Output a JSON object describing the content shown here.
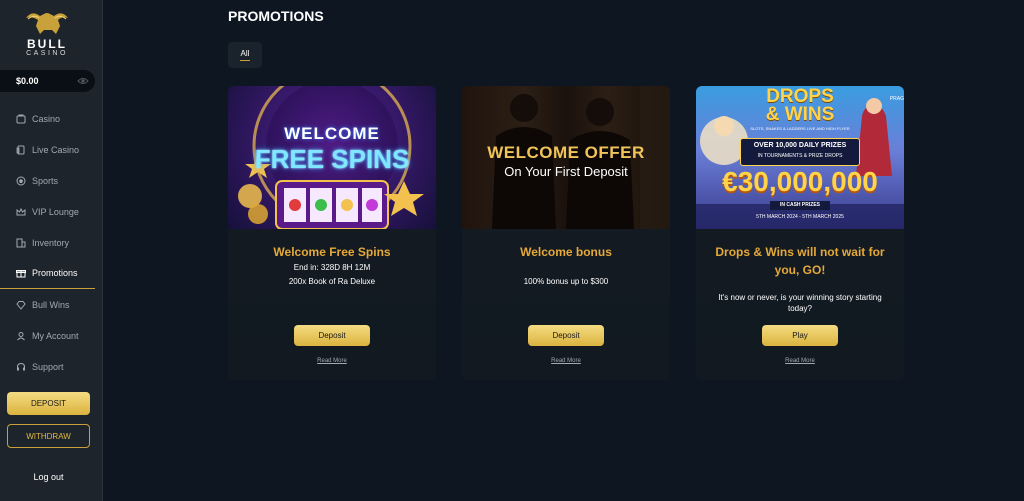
{
  "brand": {
    "word": "BULL",
    "sub": "CASINO"
  },
  "balance": {
    "amount": "$0.00"
  },
  "sidebar": {
    "items": [
      {
        "label": "Casino",
        "icon": "casino-icon"
      },
      {
        "label": "Live Casino",
        "icon": "live-casino-icon"
      },
      {
        "label": "Sports",
        "icon": "sports-icon"
      },
      {
        "label": "VIP Lounge",
        "icon": "crown-icon"
      },
      {
        "label": "Inventory",
        "icon": "inventory-icon"
      },
      {
        "label": "Promotions",
        "icon": "gift-icon",
        "active": true
      },
      {
        "label": "Bull Wins",
        "icon": "diamond-icon"
      },
      {
        "label": "My Account",
        "icon": "user-icon"
      },
      {
        "label": "Support",
        "icon": "headset-icon"
      }
    ],
    "deposit_label": "DEPOSIT",
    "withdraw_label": "WITHDRAW",
    "logout_label": "Log out"
  },
  "page": {
    "title": "PROMOTIONS",
    "filter_tab": "All"
  },
  "cards": [
    {
      "title": "Welcome Free Spins",
      "lines": [
        "End in: 328D 8H 12M",
        "200x Book of Ra Deluxe"
      ],
      "button": "Deposit",
      "link": "Read More",
      "image_text": {
        "line1": "WELCOME",
        "line2": "FREE SPINS"
      }
    },
    {
      "title": "Welcome bonus",
      "lines": [
        "100% bonus up to $300"
      ],
      "button": "Deposit",
      "link": "Read More",
      "image_text": {
        "line1": "WELCOME OFFER",
        "line2": "On Your First Deposit"
      }
    },
    {
      "title": "Drops & Wins will not wait for you, GO!",
      "lines": [
        "It's now or never, is your winning story starting today?"
      ],
      "button": "Play",
      "link": "Read More",
      "image_text": {
        "line1": "DROPS",
        "line2": "& WINS",
        "line3": "SLOTS, SNAKES & LADDERS LIVE AND HIGH FLYER",
        "line4": "OVER 10,000 DAILY PRIZES",
        "line5": "IN TOURNAMENTS & PRIZE DROPS",
        "line6": "€30,000,000",
        "line7": "IN CASH PRIZES",
        "line8": "5TH MARCH 2024 - 5TH MARCH 2025",
        "corner": "PRAG"
      }
    }
  ],
  "colors": {
    "gold": "#e5a93a",
    "accent_gold": "#c9a13a",
    "bg": "#0e1621",
    "sidebar": "#1d242c"
  }
}
